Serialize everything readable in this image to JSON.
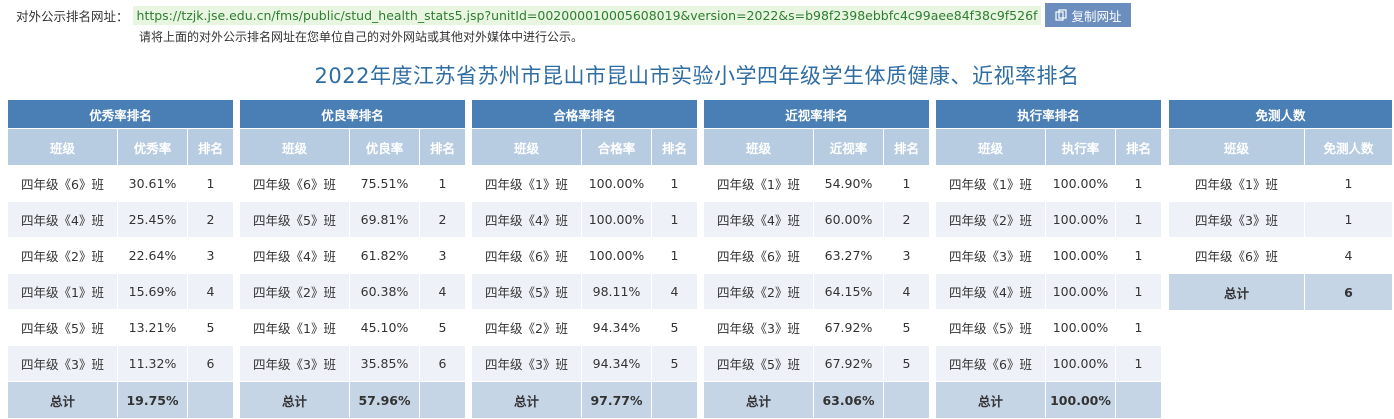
{
  "publish": {
    "label": "对外公示排名网址：",
    "url": "https://tzjk.jse.edu.cn/fms/public/stud_health_stats5.jsp?unitId=002000010005608019&version=2022&s=b98f2398ebbfc4c99aee84f38c9f526f",
    "copy_label": "复制网址",
    "hint": "请将上面的对外公示排名网址在您单位自己的对外网站或其他对外媒体中进行公示。"
  },
  "title": "2022年度江苏省苏州市昆山市昆山市实验小学四年级学生体质健康、近视率排名",
  "tables": [
    {
      "title": "优秀率排名",
      "headers": [
        "班级",
        "优秀率",
        "排名"
      ],
      "rows": [
        [
          "四年级《6》班",
          "30.61%",
          "1"
        ],
        [
          "四年级《4》班",
          "25.45%",
          "2"
        ],
        [
          "四年级《2》班",
          "22.64%",
          "3"
        ],
        [
          "四年级《1》班",
          "15.69%",
          "4"
        ],
        [
          "四年级《5》班",
          "13.21%",
          "5"
        ],
        [
          "四年级《3》班",
          "11.32%",
          "6"
        ]
      ],
      "total": [
        "总计",
        "19.75%",
        ""
      ]
    },
    {
      "title": "优良率排名",
      "headers": [
        "班级",
        "优良率",
        "排名"
      ],
      "rows": [
        [
          "四年级《6》班",
          "75.51%",
          "1"
        ],
        [
          "四年级《5》班",
          "69.81%",
          "2"
        ],
        [
          "四年级《4》班",
          "61.82%",
          "3"
        ],
        [
          "四年级《2》班",
          "60.38%",
          "4"
        ],
        [
          "四年级《1》班",
          "45.10%",
          "5"
        ],
        [
          "四年级《3》班",
          "35.85%",
          "6"
        ]
      ],
      "total": [
        "总计",
        "57.96%",
        ""
      ]
    },
    {
      "title": "合格率排名",
      "headers": [
        "班级",
        "合格率",
        "排名"
      ],
      "rows": [
        [
          "四年级《1》班",
          "100.00%",
          "1"
        ],
        [
          "四年级《4》班",
          "100.00%",
          "1"
        ],
        [
          "四年级《6》班",
          "100.00%",
          "1"
        ],
        [
          "四年级《5》班",
          "98.11%",
          "4"
        ],
        [
          "四年级《2》班",
          "94.34%",
          "5"
        ],
        [
          "四年级《3》班",
          "94.34%",
          "5"
        ]
      ],
      "total": [
        "总计",
        "97.77%",
        ""
      ]
    },
    {
      "title": "近视率排名",
      "headers": [
        "班级",
        "近视率",
        "排名"
      ],
      "rows": [
        [
          "四年级《1》班",
          "54.90%",
          "1"
        ],
        [
          "四年级《4》班",
          "60.00%",
          "2"
        ],
        [
          "四年级《6》班",
          "63.27%",
          "3"
        ],
        [
          "四年级《2》班",
          "64.15%",
          "4"
        ],
        [
          "四年级《3》班",
          "67.92%",
          "5"
        ],
        [
          "四年级《5》班",
          "67.92%",
          "5"
        ]
      ],
      "total": [
        "总计",
        "63.06%",
        ""
      ]
    },
    {
      "title": "执行率排名",
      "headers": [
        "班级",
        "执行率",
        "排名"
      ],
      "rows": [
        [
          "四年级《1》班",
          "100.00%",
          "1"
        ],
        [
          "四年级《2》班",
          "100.00%",
          "1"
        ],
        [
          "四年级《3》班",
          "100.00%",
          "1"
        ],
        [
          "四年级《4》班",
          "100.00%",
          "1"
        ],
        [
          "四年级《5》班",
          "100.00%",
          "1"
        ],
        [
          "四年级《6》班",
          "100.00%",
          "1"
        ]
      ],
      "total": [
        "总计",
        "100.00%",
        ""
      ]
    }
  ],
  "exempt": {
    "title": "免测人数",
    "headers": [
      "班级",
      "免测人数"
    ],
    "rows": [
      [
        "四年级《1》班",
        "1"
      ],
      [
        "四年级《3》班",
        "1"
      ],
      [
        "四年级《6》班",
        "4"
      ]
    ],
    "total": [
      "总计",
      "6"
    ]
  }
}
